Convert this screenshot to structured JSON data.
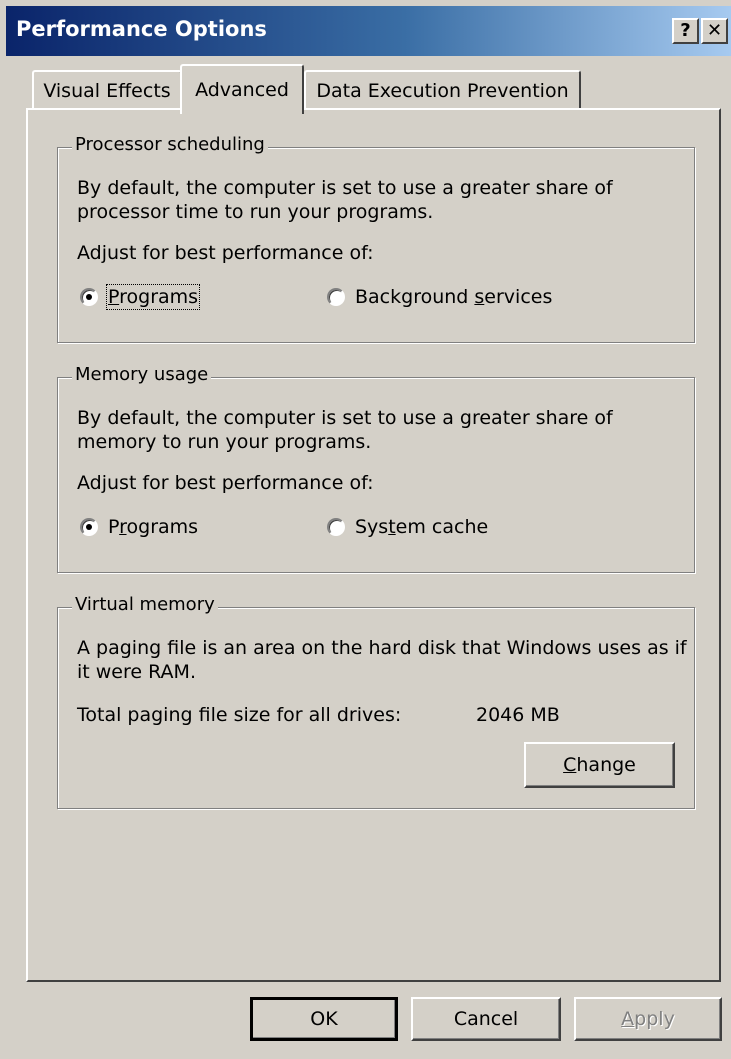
{
  "window": {
    "title": "Performance Options",
    "help_btn": "?",
    "close_btn": "✕"
  },
  "tabs": [
    {
      "label": "Visual Effects",
      "active": false
    },
    {
      "label": "Advanced",
      "active": true
    },
    {
      "label": "Data Execution Prevention",
      "active": false
    }
  ],
  "processor": {
    "legend": "Processor scheduling",
    "description": "By default, the computer is set to use a greater share of processor time to run your programs.",
    "adjust": "Adjust for best performance of:",
    "option1_pre": "",
    "option1_u": "P",
    "option1_post": "rograms",
    "option2_pre": "Background ",
    "option2_u": "s",
    "option2_post": "ervices",
    "selected": "Programs"
  },
  "memory": {
    "legend": "Memory usage",
    "description": "By default, the computer is set to use a greater share of memory to run your programs.",
    "adjust": "Adjust for best performance of:",
    "option1_pre": "P",
    "option1_u": "r",
    "option1_post": "ograms",
    "option2_pre": "Sys",
    "option2_u": "t",
    "option2_post": "em cache",
    "selected": "Programs"
  },
  "virtual": {
    "legend": "Virtual memory",
    "description": "A paging file is an area on the hard disk that Windows uses as if it were RAM.",
    "paging_label": "Total paging file size for all drives:",
    "paging_value": "2046 MB",
    "change_u": "C",
    "change_post": "hange"
  },
  "footer": {
    "ok": "OK",
    "cancel": "Cancel",
    "apply_u": "A",
    "apply_post": "pply"
  }
}
